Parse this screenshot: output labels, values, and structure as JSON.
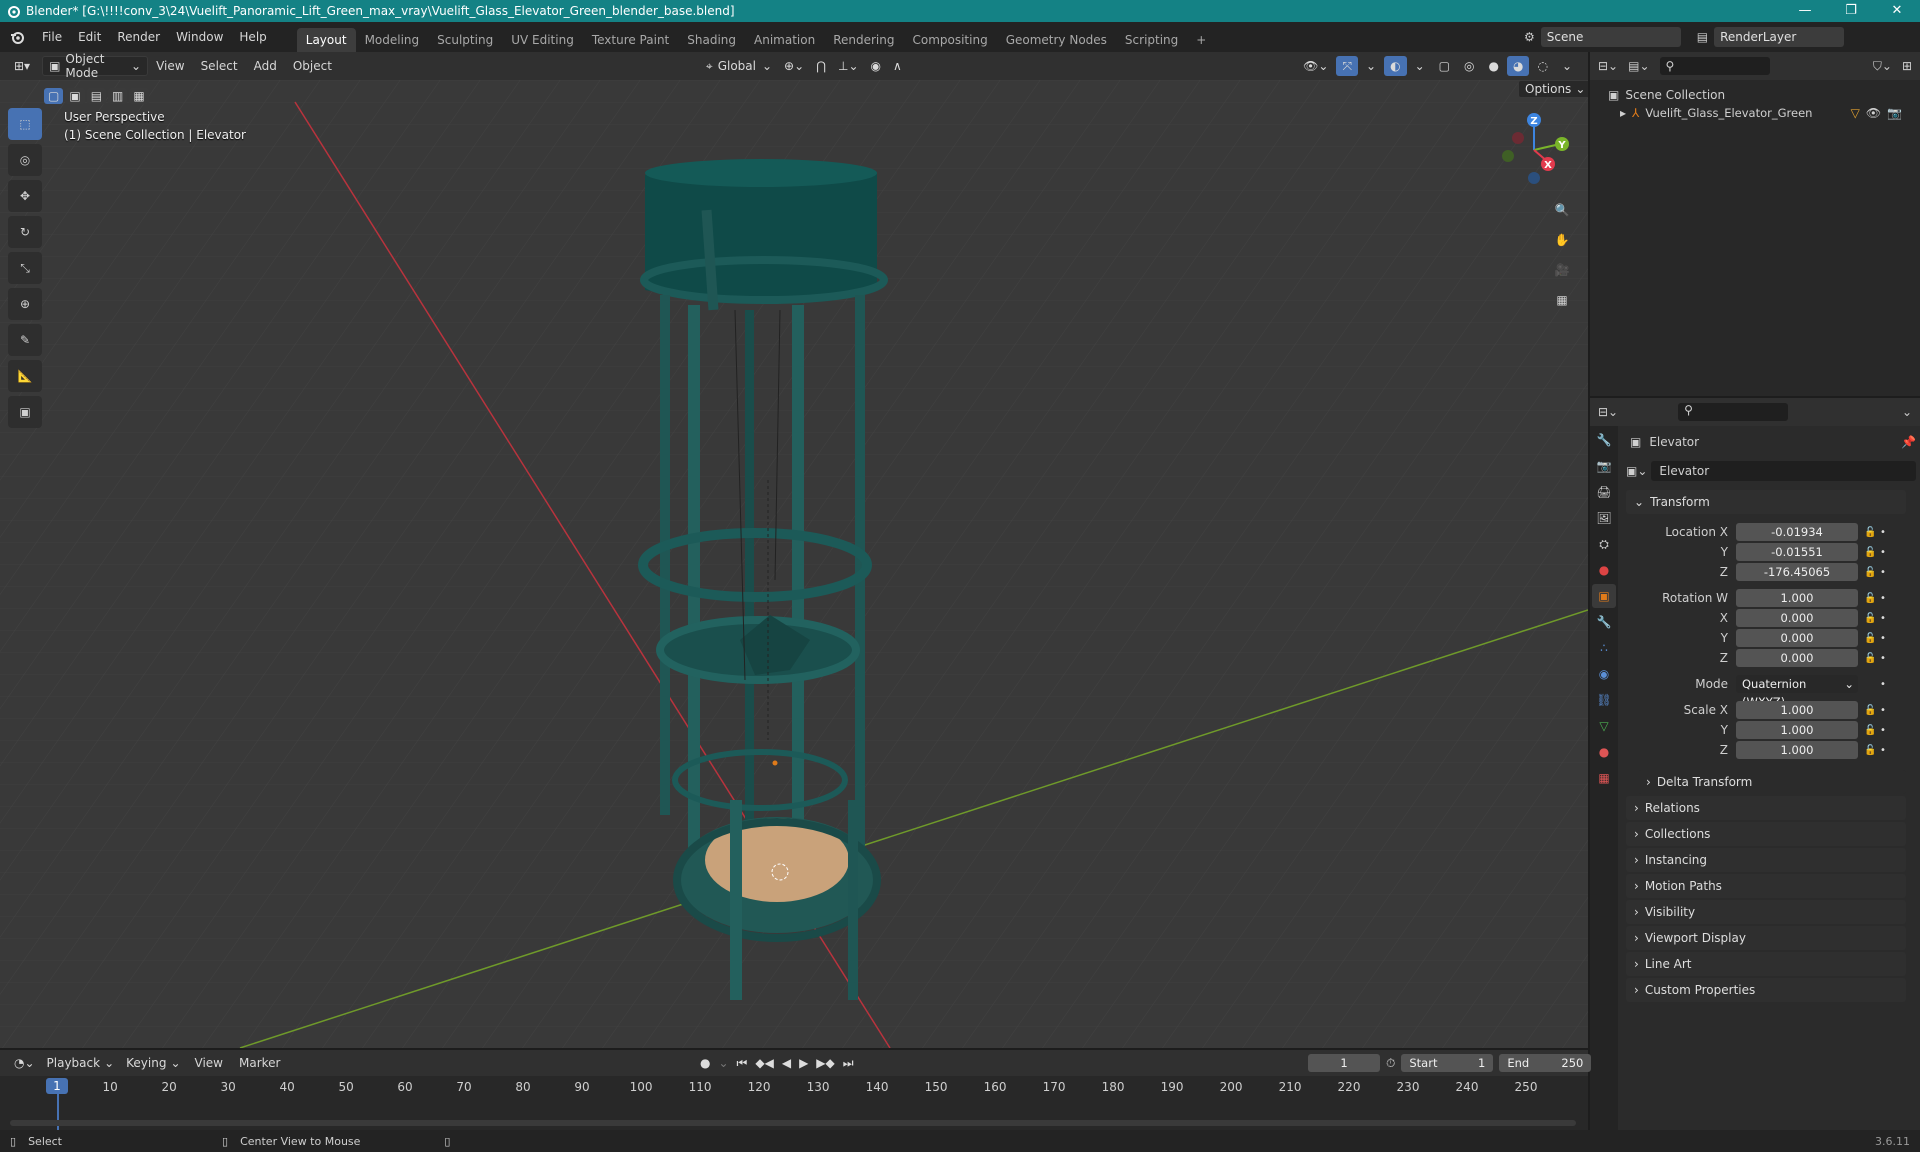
{
  "window": {
    "title": "Blender* [G:\\!!!!conv_3\\24\\Vuelift_Panoramic_Lift_Green_max_vray\\Vuelift_Glass_Elevator_Green_blender_base.blend]",
    "minimize": "—",
    "maximize": "❐",
    "close": "✕"
  },
  "menu": [
    "File",
    "Edit",
    "Render",
    "Window",
    "Help"
  ],
  "workspaces": [
    "Layout",
    "Modeling",
    "Sculpting",
    "UV Editing",
    "Texture Paint",
    "Shading",
    "Animation",
    "Rendering",
    "Compositing",
    "Geometry Nodes",
    "Scripting"
  ],
  "active_workspace": "Layout",
  "add_workspace": "+",
  "scene": "Scene",
  "view_layer": "RenderLayer",
  "viewport_header": {
    "mode": "Object Mode",
    "menus": [
      "View",
      "Select",
      "Add",
      "Object"
    ],
    "orientation": "Global",
    "options": "Options"
  },
  "viewport_info": {
    "line1": "User Perspective",
    "line2": "(1) Scene Collection | Elevator"
  },
  "gizmo": {
    "z": "Z",
    "y": "Y",
    "x": "X"
  },
  "outliner": {
    "root": "Scene Collection",
    "item": "Vuelift_Glass_Elevator_Green",
    "search_placeholder": ""
  },
  "properties": {
    "object_name": "Elevator",
    "object_field": "Elevator",
    "transform_header": "Transform",
    "location": {
      "label_x": "Location X",
      "label_y": "Y",
      "label_z": "Z",
      "x": "-0.01934",
      "y": "-0.01551",
      "z": "-176.45065"
    },
    "rotation": {
      "label_w": "Rotation W",
      "label_x": "X",
      "label_y": "Y",
      "label_z": "Z",
      "w": "1.000",
      "x": "0.000",
      "y": "0.000",
      "z": "0.000"
    },
    "mode_label": "Mode",
    "mode": "Quaternion (WXYZ)",
    "scale": {
      "label_x": "Scale X",
      "label_y": "Y",
      "label_z": "Z",
      "x": "1.000",
      "y": "1.000",
      "z": "1.000"
    },
    "delta": "Delta Transform",
    "panels": [
      "Relations",
      "Collections",
      "Instancing",
      "Motion Paths",
      "Visibility",
      "Viewport Display",
      "Line Art",
      "Custom Properties"
    ]
  },
  "timeline": {
    "menus": [
      "Playback",
      "Keying",
      "View",
      "Marker"
    ],
    "current_frame": "1",
    "start_label": "Start",
    "start": "1",
    "end_label": "End",
    "end": "250",
    "ticks": [
      "1",
      "10",
      "20",
      "30",
      "40",
      "50",
      "60",
      "70",
      "80",
      "90",
      "100",
      "110",
      "120",
      "130",
      "140",
      "150",
      "160",
      "170",
      "180",
      "190",
      "200",
      "210",
      "220",
      "230",
      "240",
      "250"
    ]
  },
  "statusbar": {
    "select": "Select",
    "center": "Center View to Mouse",
    "version": "3.6.11"
  },
  "colors": {
    "title_bg": "#148285",
    "accent": "#4772b3",
    "object_orange": "#e07b1a",
    "axis_x": "#e23a4d",
    "axis_y": "#7ab52a",
    "axis_z": "#3d85e0"
  }
}
